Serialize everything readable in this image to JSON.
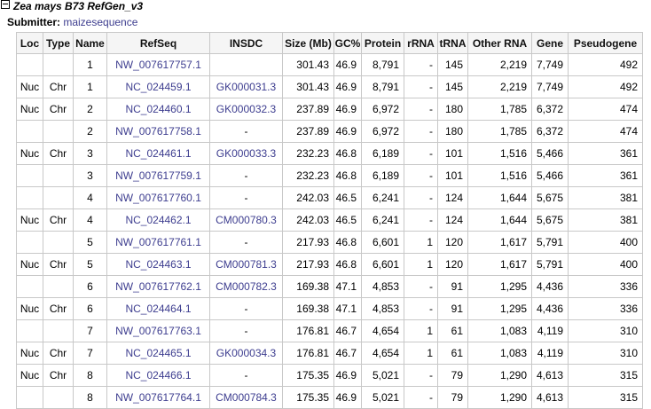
{
  "header": {
    "title": "Zea mays B73 RefGen_v3",
    "submitter_label": "Submitter:",
    "submitter_name": "maizesequence"
  },
  "table": {
    "columns": [
      "Loc",
      "Type",
      "Name",
      "RefSeq",
      "INSDC",
      "Size (Mb)",
      "GC%",
      "Protein",
      "rRNA",
      "tRNA",
      "Other RNA",
      "Gene",
      "Pseudogene"
    ],
    "rows": [
      [
        "",
        "",
        "1",
        "NW_007617757.1",
        "",
        "301.43",
        "46.9",
        "8,791",
        "-",
        "145",
        "2,219",
        "7,749",
        "492"
      ],
      [
        "Nuc",
        "Chr",
        "1",
        "NC_024459.1",
        "GK000031.3",
        "301.43",
        "46.9",
        "8,791",
        "-",
        "145",
        "2,219",
        "7,749",
        "492"
      ],
      [
        "Nuc",
        "Chr",
        "2",
        "NC_024460.1",
        "GK000032.3",
        "237.89",
        "46.9",
        "6,972",
        "-",
        "180",
        "1,785",
        "6,372",
        "474"
      ],
      [
        "",
        "",
        "2",
        "NW_007617758.1",
        "-",
        "237.89",
        "46.9",
        "6,972",
        "-",
        "180",
        "1,785",
        "6,372",
        "474"
      ],
      [
        "Nuc",
        "Chr",
        "3",
        "NC_024461.1",
        "GK000033.3",
        "232.23",
        "46.8",
        "6,189",
        "-",
        "101",
        "1,516",
        "5,466",
        "361"
      ],
      [
        "",
        "",
        "3",
        "NW_007617759.1",
        "-",
        "232.23",
        "46.8",
        "6,189",
        "-",
        "101",
        "1,516",
        "5,466",
        "361"
      ],
      [
        "",
        "",
        "4",
        "NW_007617760.1",
        "-",
        "242.03",
        "46.5",
        "6,241",
        "-",
        "124",
        "1,644",
        "5,675",
        "381"
      ],
      [
        "Nuc",
        "Chr",
        "4",
        "NC_024462.1",
        "CM000780.3",
        "242.03",
        "46.5",
        "6,241",
        "-",
        "124",
        "1,644",
        "5,675",
        "381"
      ],
      [
        "",
        "",
        "5",
        "NW_007617761.1",
        "-",
        "217.93",
        "46.8",
        "6,601",
        "1",
        "120",
        "1,617",
        "5,791",
        "400"
      ],
      [
        "Nuc",
        "Chr",
        "5",
        "NC_024463.1",
        "CM000781.3",
        "217.93",
        "46.8",
        "6,601",
        "1",
        "120",
        "1,617",
        "5,791",
        "400"
      ],
      [
        "",
        "",
        "6",
        "NW_007617762.1",
        "CM000782.3",
        "169.38",
        "47.1",
        "4,853",
        "-",
        "91",
        "1,295",
        "4,436",
        "336"
      ],
      [
        "Nuc",
        "Chr",
        "6",
        "NC_024464.1",
        "-",
        "169.38",
        "47.1",
        "4,853",
        "-",
        "91",
        "1,295",
        "4,436",
        "336"
      ],
      [
        "",
        "",
        "7",
        "NW_007617763.1",
        "-",
        "176.81",
        "46.7",
        "4,654",
        "1",
        "61",
        "1,083",
        "4,119",
        "310"
      ],
      [
        "Nuc",
        "Chr",
        "7",
        "NC_024465.1",
        "GK000034.3",
        "176.81",
        "46.7",
        "4,654",
        "1",
        "61",
        "1,083",
        "4,119",
        "310"
      ],
      [
        "Nuc",
        "Chr",
        "8",
        "NC_024466.1",
        "-",
        "175.35",
        "46.9",
        "5,021",
        "-",
        "79",
        "1,290",
        "4,613",
        "315"
      ],
      [
        "",
        "",
        "8",
        "NW_007617764.1",
        "CM000784.3",
        "175.35",
        "46.9",
        "5,021",
        "-",
        "79",
        "1,290",
        "4,613",
        "315"
      ]
    ]
  },
  "colors": {
    "link": "#3d3d8f",
    "border": "#c8c8c8",
    "header_bg": "#f5f5f5"
  }
}
